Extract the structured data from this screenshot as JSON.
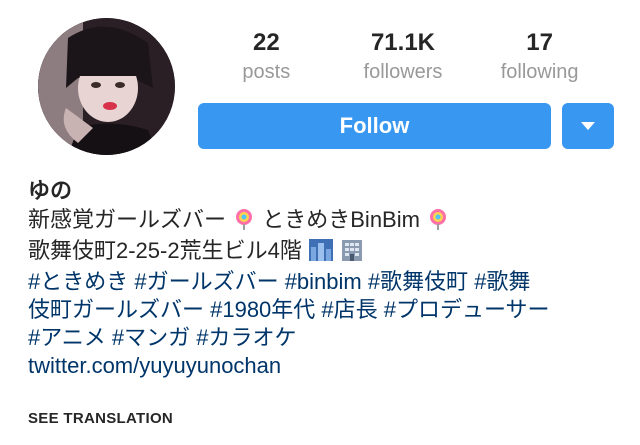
{
  "profile": {
    "stats": [
      {
        "value": "22",
        "label": "posts"
      },
      {
        "value": "71.1K",
        "label": "followers"
      },
      {
        "value": "17",
        "label": "following"
      }
    ],
    "follow_label": "Follow",
    "accent_color": "#3897f0",
    "link_color": "#003569"
  },
  "bio": {
    "name": "ゆの",
    "line1_a": "新感覚ガールズバー",
    "line1_b": " ときめきBinBim",
    "line2": "歌舞伎町2-25-2荒生ビル4階",
    "line1_icons": [
      "lollipop-icon",
      "lollipop-icon"
    ],
    "line2_icons": [
      "cityscape-icon",
      "office-building-icon"
    ],
    "hashtags_line1": "#ときめき #ガールズバー  #binbim #歌舞伎町 #歌舞",
    "hashtags_line2": "伎町ガールズバー #1980年代 #店長 #プロデューサー",
    "hashtags_line3": "#アニメ #マンガ #カラオケ",
    "link": "twitter.com/yuyuyunochan",
    "see_translation": "SEE TRANSLATION"
  }
}
